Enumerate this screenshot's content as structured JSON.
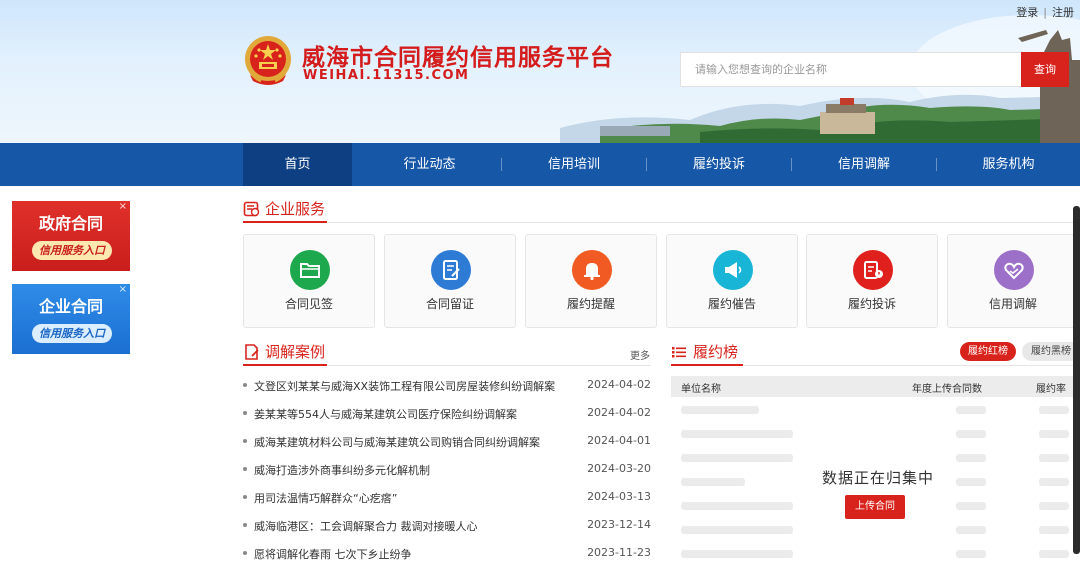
{
  "auth": {
    "login": "登录",
    "separator": "|",
    "register": "注册"
  },
  "header": {
    "title": "威海市合同履约信用服务平台",
    "domain": "WEIHAI.11315.COM"
  },
  "search": {
    "placeholder": "请输入您想查询的企业名称",
    "button": "查询"
  },
  "nav": {
    "active_index": 0,
    "items": [
      {
        "label": "首页"
      },
      {
        "label": "行业动态"
      },
      {
        "label": "信用培训"
      },
      {
        "label": "履约投诉"
      },
      {
        "label": "信用调解"
      },
      {
        "label": "服务机构"
      }
    ]
  },
  "ads": [
    {
      "title": "政府合同",
      "subtitle": "信用服务入口",
      "close": "×",
      "color": "#d8231c"
    },
    {
      "title": "企业合同",
      "subtitle": "信用服务入口",
      "close": "×",
      "color": "#1b6fd1"
    }
  ],
  "services": {
    "title": "企业服务",
    "cards": [
      {
        "label": "合同见签",
        "icon": "folder-icon",
        "color": "#1ea84e"
      },
      {
        "label": "合同留证",
        "icon": "document-edit-icon",
        "color": "#2e7bd6"
      },
      {
        "label": "履约提醒",
        "icon": "bell-icon",
        "color": "#f15a22"
      },
      {
        "label": "履约催告",
        "icon": "megaphone-icon",
        "color": "#19b5d6"
      },
      {
        "label": "履约投诉",
        "icon": "complaint-icon",
        "color": "#e0201d"
      },
      {
        "label": "信用调解",
        "icon": "handshake-heart-icon",
        "color": "#9c6fc9"
      }
    ]
  },
  "cases": {
    "title": "调解案例",
    "more": "更多",
    "items": [
      {
        "text": "文登区刘某某与威海XX装饰工程有限公司房屋装修纠纷调解案",
        "date": "2024-04-02"
      },
      {
        "text": "姜某某等554人与威海某建筑公司医疗保险纠纷调解案",
        "date": "2024-04-02"
      },
      {
        "text": "威海某建筑材料公司与威海某建筑公司购销合同纠纷调解案",
        "date": "2024-04-01"
      },
      {
        "text": "威海打造涉外商事纠纷多元化解机制",
        "date": "2024-03-20"
      },
      {
        "text": "用司法温情巧解群众“心疙瘩”",
        "date": "2024-03-13"
      },
      {
        "text": "威海临港区：工会调解聚合力 裁调对接暖人心",
        "date": "2023-12-14"
      },
      {
        "text": "愿将调解化春雨 七次下乡止纷争",
        "date": "2023-11-23"
      }
    ]
  },
  "ranking": {
    "title": "履约榜",
    "tab_red": "履约红榜",
    "tab_black": "履约黑榜",
    "columns": {
      "name": "单位名称",
      "count": "年度上传合同数",
      "rate": "履约率"
    },
    "overlay_text": "数据正在归集中",
    "upload_button": "上传合同"
  }
}
